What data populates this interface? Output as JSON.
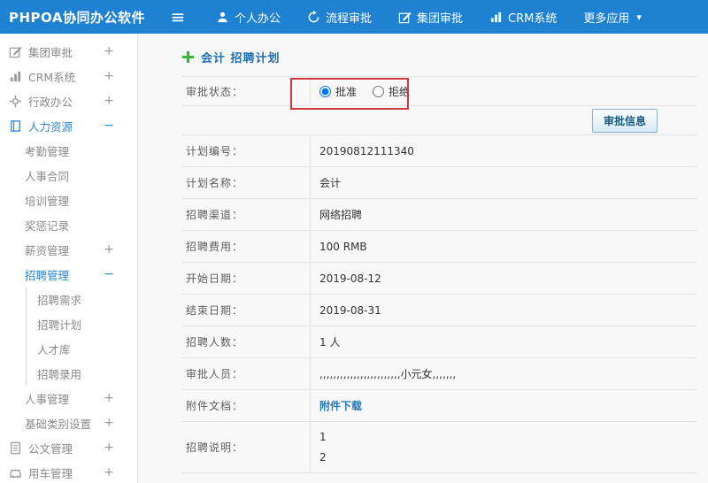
{
  "icons": {
    "hamburger": "≡",
    "caret_down": "▾"
  },
  "colors": {
    "header_blue": "#1e81d2",
    "accent_blue": "#2a85d0",
    "green_plus": "#35b53a",
    "annotation_red": "#cc3b3b",
    "link_blue": "#2a7ab9"
  },
  "header": {
    "logo": "PHPOA协同办公软件",
    "nav": [
      {
        "label": "个人办公"
      },
      {
        "label": "流程审批"
      },
      {
        "label": "集团审批"
      },
      {
        "label": "CRM系统"
      },
      {
        "label": "更多应用"
      }
    ]
  },
  "sidebar": {
    "items": [
      {
        "label": "集团审批",
        "toggle": "+"
      },
      {
        "label": "CRM系统",
        "toggle": "+"
      },
      {
        "label": "行政办公",
        "toggle": "+"
      },
      {
        "label": "人力资源",
        "toggle": "−"
      },
      {
        "label": "考勤管理",
        "toggle": ""
      },
      {
        "label": "人事合同",
        "toggle": ""
      },
      {
        "label": "培训管理",
        "toggle": ""
      },
      {
        "label": "奖惩记录",
        "toggle": ""
      },
      {
        "label": "薪资管理",
        "toggle": "+"
      },
      {
        "label": "招聘管理",
        "toggle": "−"
      },
      {
        "label": "招聘需求",
        "toggle": ""
      },
      {
        "label": "招聘计划",
        "toggle": ""
      },
      {
        "label": "人才库",
        "toggle": ""
      },
      {
        "label": "招聘录用",
        "toggle": ""
      },
      {
        "label": "人事管理",
        "toggle": "+"
      },
      {
        "label": "基础类别设置",
        "toggle": "+"
      },
      {
        "label": "公文管理",
        "toggle": "+"
      },
      {
        "label": "用车管理",
        "toggle": "+"
      }
    ]
  },
  "main": {
    "title": "会计 招聘计划",
    "status": {
      "label": "审批状态：",
      "approve": "批准",
      "reject": "拒绝",
      "approve_checked": true,
      "reject_checked": false
    },
    "approval_button": "审批信息",
    "fields": [
      {
        "label": "计划编号：",
        "value": "20190812111340"
      },
      {
        "label": "计划名称：",
        "value": "会计"
      },
      {
        "label": "招聘渠道：",
        "value": "网络招聘"
      },
      {
        "label": "招聘费用：",
        "value": "100 RMB"
      },
      {
        "label": "开始日期：",
        "value": "2019-08-12"
      },
      {
        "label": "结束日期：",
        "value": "2019-08-31"
      },
      {
        "label": "招聘人数：",
        "value": "1 人"
      },
      {
        "label": "审批人员：",
        "value": ",,,,,,,,,,,,,,,,,,,,,,,,小元女,,,,,,,"
      },
      {
        "label": "附件文档：",
        "value": "附件下载"
      },
      {
        "label": "招聘说明：",
        "value": "1\n2"
      }
    ]
  }
}
